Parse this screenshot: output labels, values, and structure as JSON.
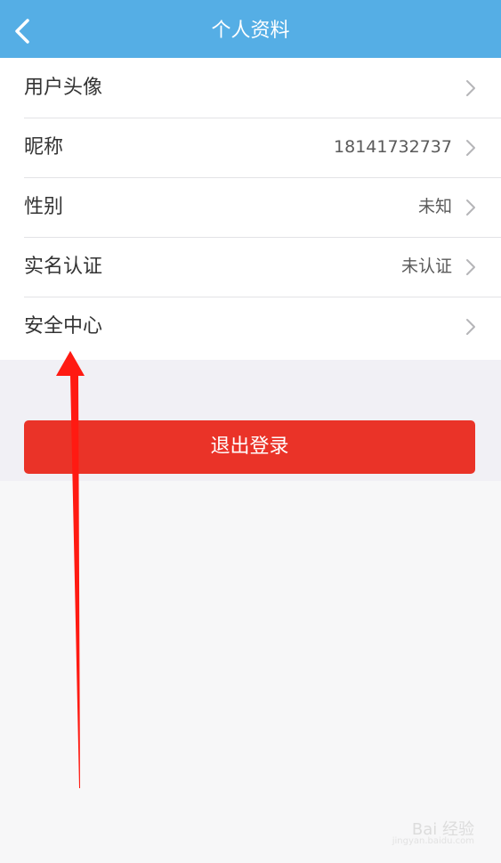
{
  "header": {
    "title": "个人资料",
    "back_icon": "chevron-left-icon"
  },
  "profile": {
    "rows": [
      {
        "label": "用户头像",
        "value": ""
      },
      {
        "label": "昵称",
        "value": "18141732737"
      },
      {
        "label": "性别",
        "value": "未知"
      },
      {
        "label": "实名认证",
        "value": "未认证"
      },
      {
        "label": "安全中心",
        "value": ""
      }
    ]
  },
  "logout": {
    "label": "退出登录"
  },
  "watermark": {
    "text": "Bai 经验",
    "sub": "jingyan.baidu.com"
  },
  "colors": {
    "header_bg": "#55aee5",
    "logout_bg": "#ea3328",
    "annotation_arrow": "#ff1a12"
  }
}
